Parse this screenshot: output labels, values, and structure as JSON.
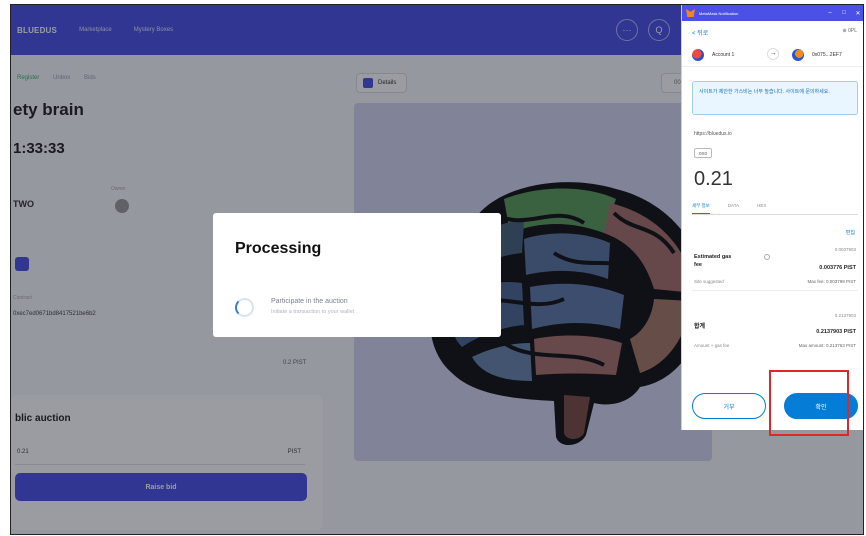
{
  "nav": {
    "logo": "BLUEDUS",
    "links": [
      "Marketplace",
      "Mystery Boxes"
    ],
    "more_icon": "more-dots-icon",
    "search_icon": "search-icon",
    "more_glyph": "···",
    "search_glyph": "Q"
  },
  "detail": {
    "breadcrumbs": [
      "Register",
      "Unbox",
      "Bids"
    ],
    "title": "ety brain",
    "timer": "1:33:33",
    "owner_label": "Owner",
    "seller": "TWO",
    "contract_label": "Contract",
    "contract_address": "0xec7ed0671bd8417521be6b2",
    "min_bid": "0.2 PIST"
  },
  "auction": {
    "title": "blic auction",
    "bid_value": "0.21",
    "bid_unit": "PIST",
    "raise_label": "Raise bid"
  },
  "media": {
    "details_tab": "Details",
    "side_tab": "00"
  },
  "modal": {
    "title": "Processing",
    "step_title": "Participate in the auction",
    "step_subtitle": "Initiate a transaction to your wallet"
  },
  "metamask": {
    "window_title": "MetaMask Notification",
    "window_controls": [
      "–",
      "□",
      "✕"
    ],
    "back_label": "< 뒤로",
    "network": "⊕ 0PL",
    "from_account": "Account 1",
    "arrow": "→",
    "to_account": "0x075...2EF7",
    "notice": "사이트가 제안한 가스비는 너무 높습니다. 사이트에 문의하세요.",
    "origin": "https://bluedus.io",
    "type_chip": "0X0",
    "amount": "0.21",
    "tabs": [
      "세부 정보",
      "DATA",
      "HEX"
    ],
    "edit_label": "편집",
    "gas_label": "Estimated gas fee",
    "gas_fiat": "0.0037903",
    "gas_amount": "0.003776 PIST",
    "gas_suggest": "Site suggested",
    "gas_max": "Max fee: 0.003798 PIST",
    "total_label": "합계",
    "total_fiat": "0.2137903",
    "total_amount": "0.2137903 PIST",
    "total_sub_left": "Amount + gas fee",
    "total_sub_right": "Max amount: 0.213763 PIST",
    "reject_label": "거부",
    "confirm_label": "확인"
  },
  "colors": {
    "brand": "#4b50e6",
    "metamask_blue": "#037dd6",
    "highlight": "#e0262a"
  }
}
